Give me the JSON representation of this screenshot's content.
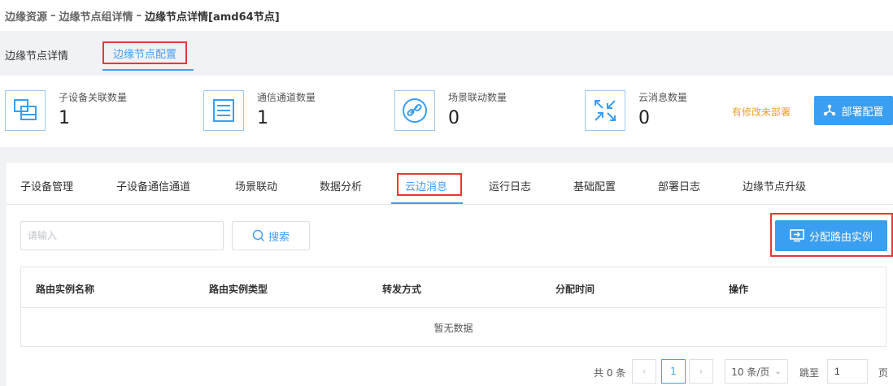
{
  "breadcrumb": {
    "items": [
      "边缘资源",
      "边缘节点组详情",
      "边缘节点详情[amd64节点]"
    ],
    "separator": "–"
  },
  "top_tabs": [
    {
      "label": "边缘节点详情",
      "active": false
    },
    {
      "label": "边缘节点配置",
      "active": true
    }
  ],
  "stats": [
    {
      "label": "子设备关联数量",
      "value": "1",
      "icon": "device-link-icon"
    },
    {
      "label": "通信通道数量",
      "value": "1",
      "icon": "channel-list-icon"
    },
    {
      "label": "场景联动数量",
      "value": "0",
      "icon": "link-icon"
    },
    {
      "label": "云消息数量",
      "value": "0",
      "icon": "arrows-icon"
    }
  ],
  "unsaved_notice": "有修改未部署",
  "deploy_button": "部署配置",
  "sub_tabs": [
    {
      "label": "子设备管理",
      "active": false
    },
    {
      "label": "子设备通信通道",
      "active": false
    },
    {
      "label": "场景联动",
      "active": false
    },
    {
      "label": "数据分析",
      "active": false
    },
    {
      "label": "云边消息",
      "active": true
    },
    {
      "label": "运行日志",
      "active": false
    },
    {
      "label": "基础配置",
      "active": false
    },
    {
      "label": "部署日志",
      "active": false
    },
    {
      "label": "边缘节点升级",
      "active": false
    }
  ],
  "search": {
    "placeholder": "请输入",
    "value": "",
    "button": "搜索"
  },
  "assign_button": "分配路由实例",
  "table": {
    "columns": [
      "路由实例名称",
      "路由实例类型",
      "转发方式",
      "分配时间",
      "操作"
    ],
    "rows": [],
    "empty_text": "暂无数据"
  },
  "pagination": {
    "total_text": "共 0 条",
    "current_page": "1",
    "page_size": "10 条/页",
    "jump_label": "跳至",
    "jump_value": "1",
    "page_suffix": "页"
  },
  "colors": {
    "accent": "#409eff",
    "primary_button": "#3a9ff0",
    "warning": "#f0a020",
    "highlight_box": "#e53935"
  }
}
